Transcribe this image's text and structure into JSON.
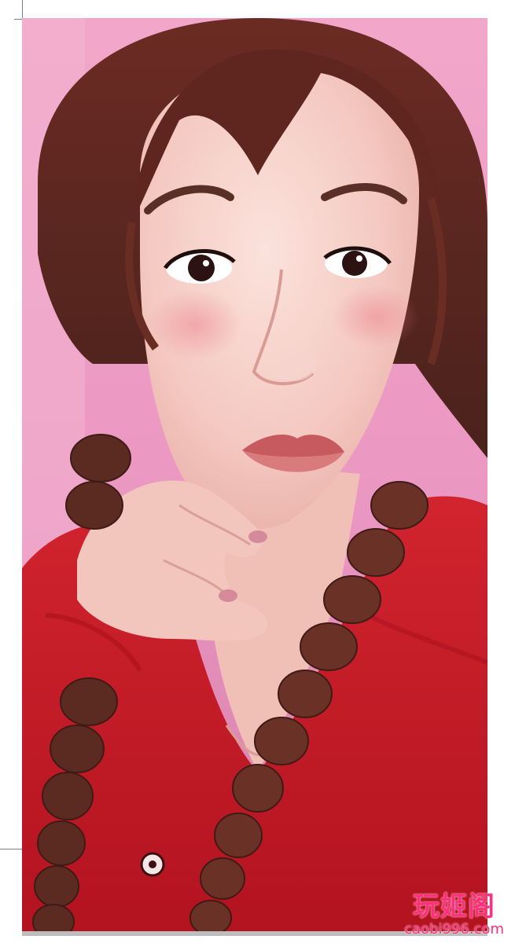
{
  "photo": {
    "alt": "Portrait of a young woman with braided hair wearing a red sweater against a pink background"
  },
  "watermark": {
    "title": "玩姬阁",
    "url": "caobi996.com"
  },
  "colors": {
    "background": "#ec9cc4",
    "sweater": "#c81e2b",
    "hair": "#5a2a22",
    "skin": "#f4c8bf",
    "watermark": "#ff2f7d"
  }
}
